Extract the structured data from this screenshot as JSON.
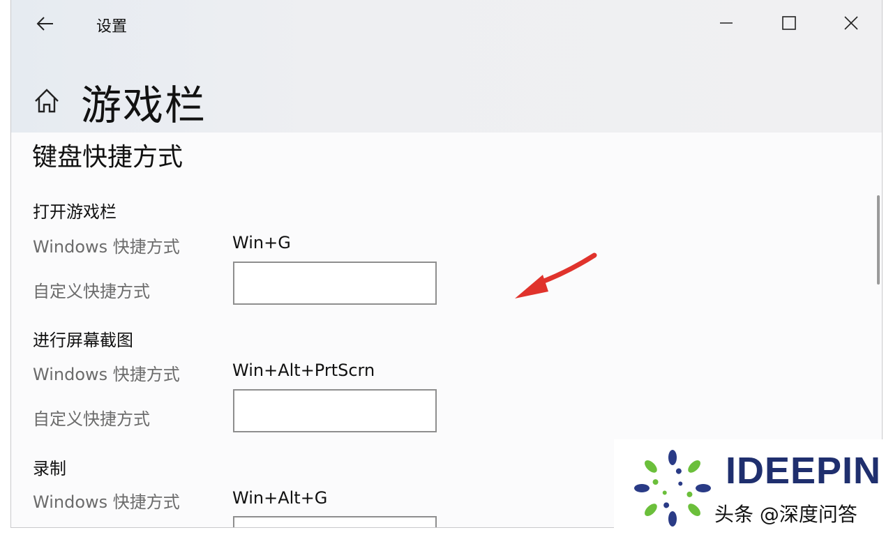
{
  "window": {
    "title": "设置",
    "controls": [
      "minimize-icon",
      "maximize-icon",
      "close-icon"
    ]
  },
  "header": {
    "page_title": "游戏栏"
  },
  "section": {
    "title": "键盘快捷方式",
    "groups": [
      {
        "title": "打开游戏栏",
        "windows_label": "Windows 快捷方式",
        "windows_value": "Win+G",
        "custom_label": "自定义快捷方式",
        "custom_value": ""
      },
      {
        "title": "进行屏幕截图",
        "windows_label": "Windows 快捷方式",
        "windows_value": "Win+Alt+PrtScrn",
        "custom_label": "自定义快捷方式",
        "custom_value": ""
      },
      {
        "title": "录制",
        "windows_label": "Windows 快捷方式",
        "windows_value": "Win+Alt+G",
        "custom_label": "",
        "custom_value": ""
      }
    ]
  },
  "annotation": {
    "arrow_color": "#e0332c"
  },
  "watermark": {
    "brand": "IDEEPIN",
    "text": "头条 @深度问答"
  },
  "colors": {
    "chrome_bg": "#eeeff2",
    "content_bg": "#fbfbfc",
    "label_gray": "#6b6b6b",
    "input_border": "#8e8e8e",
    "brand_blue": "#1f2f6e"
  }
}
